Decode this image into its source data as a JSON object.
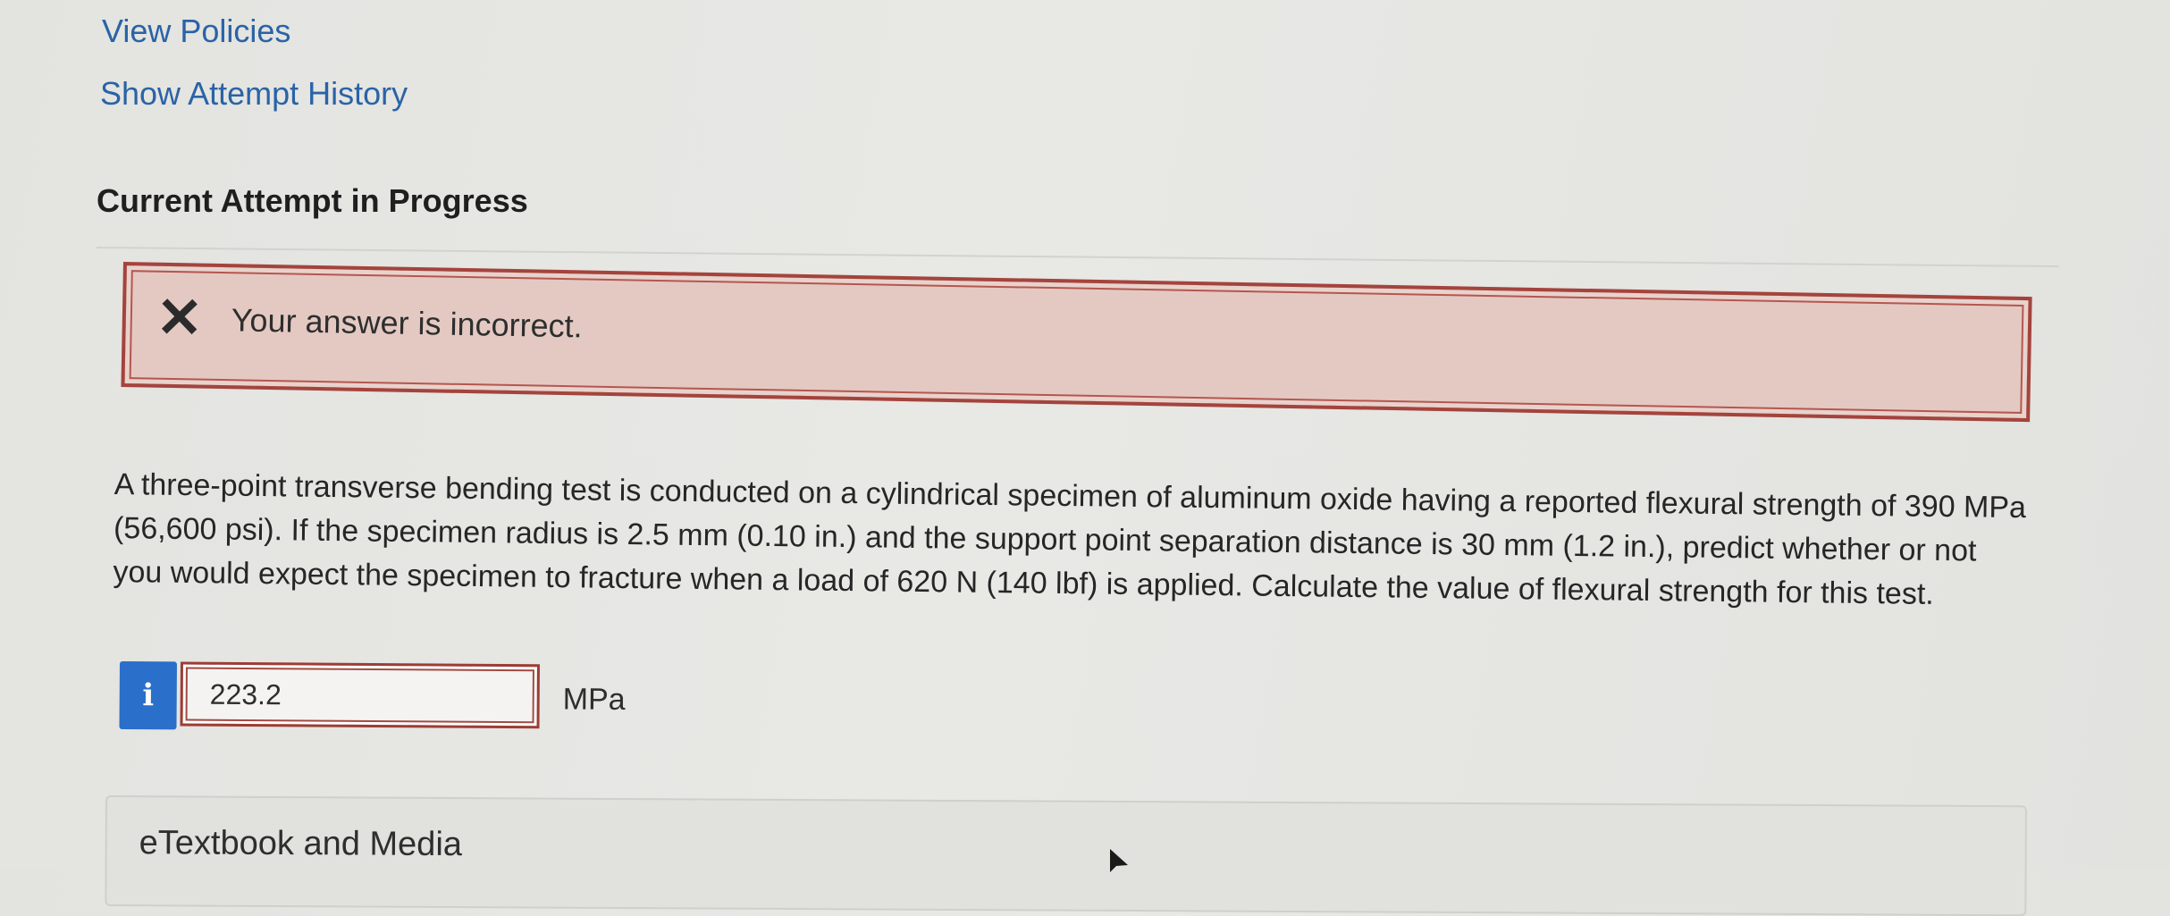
{
  "links": {
    "view_policies": "View Policies",
    "show_attempt_history": "Show Attempt History"
  },
  "section": {
    "title": "Current Attempt in Progress"
  },
  "feedback": {
    "icon": "x-mark-icon",
    "message": "Your answer is incorrect.",
    "colors": {
      "background": "#e4c9c3",
      "border": "#a3443d"
    }
  },
  "question": {
    "text": "A three-point transverse bending test is conducted on a cylindrical specimen of aluminum oxide having a reported flexural strength of 390 MPa (56,600 psi). If the specimen radius is 2.5 mm (0.10 in.) and the support point separation distance is 30 mm (1.2 in.), predict whether or not you would expect the specimen to fracture when a load of 620 N (140 lbf) is applied. Calculate the value of flexural strength for this test."
  },
  "answer": {
    "info_icon_label": "i",
    "value": "223.2",
    "unit": "MPa",
    "accent_color": "#2a6fc9"
  },
  "resources": {
    "etextbook_label": "eTextbook and Media"
  }
}
